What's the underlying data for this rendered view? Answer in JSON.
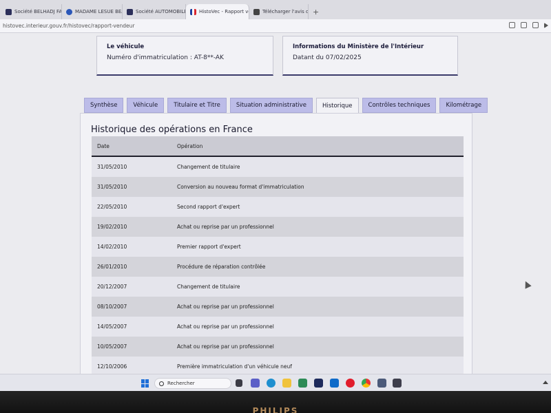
{
  "browser": {
    "tabs": [
      {
        "label": "Société BELHADJ FAZIGH",
        "icon": "p-icon",
        "active": false
      },
      {
        "label": "MADAME LESUE BEAUL...",
        "icon": "info-icon",
        "active": false
      },
      {
        "label": "Société AUTOMOBILES LE...",
        "icon": "p-icon",
        "active": false
      },
      {
        "label": "HistoVec - Rapport vendeur",
        "icon": "flag-icon",
        "active": true
      },
      {
        "label": "Télécharger l'avis de situa...",
        "icon": "document-icon",
        "active": false
      }
    ],
    "new_tab": "+",
    "url": "histovec.interieur.gouv.fr/histovec/rapport-vendeur"
  },
  "vehicle_card": {
    "title": "Le véhicule",
    "text": "Numéro d'immatriculation : AT-8**-AK"
  },
  "ministry_card": {
    "title": "Informations du Ministère de l'Intérieur",
    "text": "Datant du 07/02/2025"
  },
  "tabs": [
    {
      "label": "Synthèse",
      "active": false
    },
    {
      "label": "Véhicule",
      "active": false
    },
    {
      "label": "Titulaire et Titre",
      "active": false
    },
    {
      "label": "Situation administrative",
      "active": false
    },
    {
      "label": "Historique",
      "active": true
    },
    {
      "label": "Contrôles techniques",
      "active": false
    },
    {
      "label": "Kilométrage",
      "active": false
    }
  ],
  "history": {
    "title": "Historique des opérations en France",
    "columns": [
      "Date",
      "Opération"
    ],
    "rows": [
      [
        "31/05/2010",
        "Changement de titulaire"
      ],
      [
        "31/05/2010",
        "Conversion au nouveau format d'immatriculation"
      ],
      [
        "22/05/2010",
        "Second rapport d'expert"
      ],
      [
        "19/02/2010",
        "Achat ou reprise par un professionnel"
      ],
      [
        "14/02/2010",
        "Premier rapport d'expert"
      ],
      [
        "26/01/2010",
        "Procédure de réparation contrôlée"
      ],
      [
        "20/12/2007",
        "Changement de titulaire"
      ],
      [
        "08/10/2007",
        "Achat ou reprise par un professionnel"
      ],
      [
        "14/05/2007",
        "Achat ou reprise par un professionnel"
      ],
      [
        "10/05/2007",
        "Achat ou reprise par un professionnel"
      ],
      [
        "12/10/2006",
        "Première immatriculation d'un véhicule neuf"
      ]
    ]
  },
  "taskbar": {
    "search_placeholder": "Rechercher"
  },
  "monitor": {
    "brand": "PHILIPS"
  }
}
